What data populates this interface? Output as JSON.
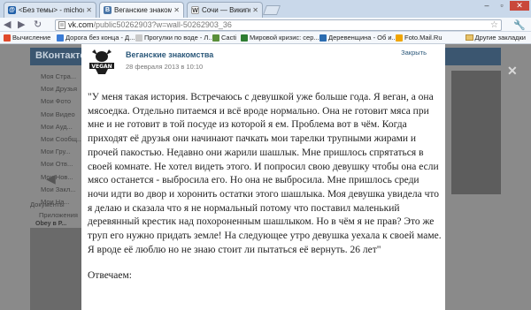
{
  "browser": {
    "tabs": [
      {
        "label": "<Без темы> - micho@mail.ru",
        "favicon": "mail-icon",
        "color": "#1f5fa8"
      },
      {
        "label": "Веганские знакомства",
        "favicon": "vk-icon",
        "color": "#4a76a8"
      },
      {
        "label": "Сочи — Википедия",
        "favicon": "wikipedia-icon",
        "color": "#333333"
      }
    ],
    "url_domain": "vk.com",
    "url_path": "/public50262903?w=wall-50262903_36",
    "bookmarks": [
      {
        "label": "Вычисление",
        "color": "#e04a2b"
      },
      {
        "label": "Дорога без конца - Д...",
        "color": "#3a7bd5"
      },
      {
        "label": "Прогулки по воде - Л...",
        "color": "#c9c9c9"
      },
      {
        "label": "Cacti",
        "color": "#5a8f3a"
      },
      {
        "label": "Мировой кризис: сер...",
        "color": "#2e7d32"
      },
      {
        "label": "Деревенщина - Об и...",
        "color": "#2b6cb0"
      },
      {
        "label": "Foto.Mail.Ru",
        "color": "#f0a500"
      }
    ],
    "other_bookmarks": "Другие закладки"
  },
  "background": {
    "logo": "ВКонтакте",
    "menu": [
      "Моя Стра...",
      "Мои Друзья",
      "Мои Фото",
      "Мои Видео",
      "Мои Ауд...",
      "Мои Сообщ...",
      "Мои Гру...",
      "Мои Отв...",
      "Мои Нов...",
      "Мои Закл...",
      "Мои На..."
    ],
    "apps": "Приложения",
    "docs": "Документы",
    "photo_title": "Obey в Р..."
  },
  "post": {
    "author": "Веганские знакомства",
    "date": "28 февраля 2013 в 10:10",
    "close_label": "Закрыть",
    "text": "\"У меня такая история. Встречаюсь с девушкой уже больше года. Я веган, а она мясоедка. Отдельно питаемся и всё вроде нормально. Она не готовит мяса при мне и не готовит в той посуде из которой я ем. Проблема вот в чём. Когда приходят её друзья они начинают пачкать мои тарелки трупными жирами и прочей пакостью. Недавно они жарили шашлык. Мне пришлось спрятаться в своей комнате. Не хотел видеть этого. И попросил свою девушку чтобы она если мясо останется - выбросила его. Но она не выбросила. Мне пришлось среди ночи идти во двор и хоронить остатки этого шашлыка. Моя девушка увидела что я делаю и сказала что я не нормальный потому что поставил маленький деревянный крестик над похороненным шашлыком. Но в чём я не прав? Это же труп его нужно придать земле! На следующее утро девушка уехала к своей маме. Я вроде её люблю но не знаю стоит ли пытаться её вернуть. 26 лет\"",
    "reply_label": "Отвечаем:"
  }
}
